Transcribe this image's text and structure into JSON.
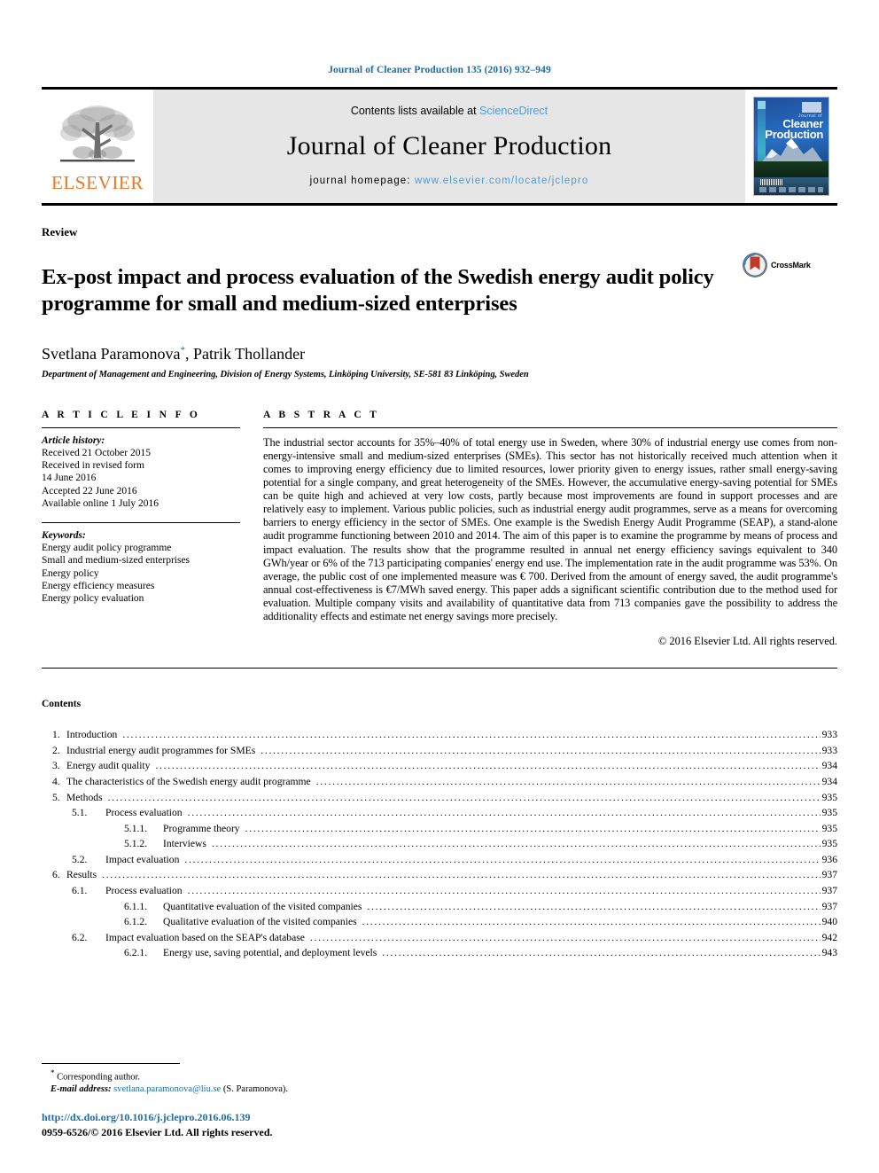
{
  "running_head": "Journal of Cleaner Production 135 (2016) 932–949",
  "masthead": {
    "publisher_name": "ELSEVIER",
    "contents_prefix": "Contents lists available at ",
    "contents_link": "ScienceDirect",
    "journal_title": "Journal of Cleaner Production",
    "homepage_prefix": "journal homepage: ",
    "homepage_url": "www.elsevier.com/locate/jclepro",
    "cover": {
      "small_label": "Journal of",
      "line1": "Cleaner",
      "line2": "Production"
    }
  },
  "article": {
    "type": "Review",
    "title": "Ex-post impact and process evaluation of the Swedish energy audit policy programme for small and medium-sized enterprises",
    "authors": "Svetlana Paramonova",
    "author_marker": "*",
    "authors_rest": ", Patrik Thollander",
    "affiliation": "Department of Management and Engineering, Division of Energy Systems, Linköping University, SE-581 83 Linköping, Sweden",
    "crossmark_label": "CrossMark"
  },
  "article_info": {
    "heading": "A R T I C L E   I N F O",
    "history_title": "Article history:",
    "history_lines": [
      "Received 21 October 2015",
      "Received in revised form",
      "14 June 2016",
      "Accepted 22 June 2016",
      "Available online 1 July 2016"
    ],
    "keywords_title": "Keywords:",
    "keywords": [
      "Energy audit policy programme",
      "Small and medium-sized enterprises",
      "Energy policy",
      "Energy efficiency measures",
      "Energy policy evaluation"
    ]
  },
  "abstract": {
    "heading": "A B S T R A C T",
    "body": "The industrial sector accounts for 35%–40% of total energy use in Sweden, where 30% of industrial energy use comes from non-energy-intensive small and medium-sized enterprises (SMEs). This sector has not historically received much attention when it comes to improving energy efficiency due to limited resources, lower priority given to energy issues, rather small energy-saving potential for a single company, and great heterogeneity of the SMEs. However, the accumulative energy-saving potential for SMEs can be quite high and achieved at very low costs, partly because most improvements are found in support processes and are relatively easy to implement. Various public policies, such as industrial energy audit programmes, serve as a means for overcoming barriers to energy efficiency in the sector of SMEs. One example is the Swedish Energy Audit Programme (SEAP), a stand-alone audit programme functioning between 2010 and 2014. The aim of this paper is to examine the programme by means of process and impact evaluation. The results show that the programme resulted in annual net energy efficiency savings equivalent to 340 GWh/year or 6% of the 713 participating companies' energy end use. The implementation rate in the audit programme was 53%. On average, the public cost of one implemented measure was € 700. Derived from the amount of energy saved, the audit programme's annual cost-effectiveness is €7/MWh saved energy. This paper adds a significant scientific contribution due to the method used for evaluation. Multiple company visits and availability of quantitative data from 713 companies gave the possibility to address the additionality effects and estimate net energy savings more precisely.",
    "copyright": "© 2016 Elsevier Ltd. All rights reserved."
  },
  "contents": {
    "heading": "Contents",
    "entries": [
      {
        "level": 1,
        "num": "1.",
        "label": "Introduction",
        "page": "933"
      },
      {
        "level": 1,
        "num": "2.",
        "label": "Industrial energy audit programmes for SMEs",
        "page": "933"
      },
      {
        "level": 1,
        "num": "3.",
        "label": "Energy audit quality",
        "page": "934"
      },
      {
        "level": 1,
        "num": "4.",
        "label": "The characteristics of the Swedish energy audit programme",
        "page": "934"
      },
      {
        "level": 1,
        "num": "5.",
        "label": "Methods",
        "page": "935"
      },
      {
        "level": 2,
        "num": "5.1.",
        "label": "Process evaluation",
        "page": "935"
      },
      {
        "level": 3,
        "num": "5.1.1.",
        "label": "Programme theory",
        "page": "935"
      },
      {
        "level": 3,
        "num": "5.1.2.",
        "label": "Interviews",
        "page": "935"
      },
      {
        "level": 2,
        "num": "5.2.",
        "label": "Impact evaluation",
        "page": "936"
      },
      {
        "level": 1,
        "num": "6.",
        "label": "Results",
        "page": "937"
      },
      {
        "level": 2,
        "num": "6.1.",
        "label": "Process evaluation",
        "page": "937"
      },
      {
        "level": 3,
        "num": "6.1.1.",
        "label": "Quantitative evaluation of the visited companies",
        "page": "937"
      },
      {
        "level": 3,
        "num": "6.1.2.",
        "label": "Qualitative evaluation of the visited companies",
        "page": "940"
      },
      {
        "level": 2,
        "num": "6.2.",
        "label": "Impact evaluation based on the SEAP's database",
        "page": "942"
      },
      {
        "level": 3,
        "num": "6.2.1.",
        "label": "Energy use, saving potential, and deployment levels",
        "page": "943"
      }
    ]
  },
  "footer": {
    "corresponding_marker": "*",
    "corresponding_label": " Corresponding author.",
    "email_label": "E-mail address:",
    "email": "svetlana.paramonova@liu.se",
    "email_suffix": " (S. Paramonova).",
    "doi": "http://dx.doi.org/10.1016/j.jclepro.2016.06.139",
    "issn": "0959-6526/© 2016 Elsevier Ltd. All rights reserved."
  },
  "colors": {
    "link_blue": "#1a6ea8",
    "light_blue": "#4f9ad0",
    "elsevier_orange": "#e87722",
    "masthead_grey": "#e6e6e6",
    "crossmark_red": "#c0392b"
  }
}
